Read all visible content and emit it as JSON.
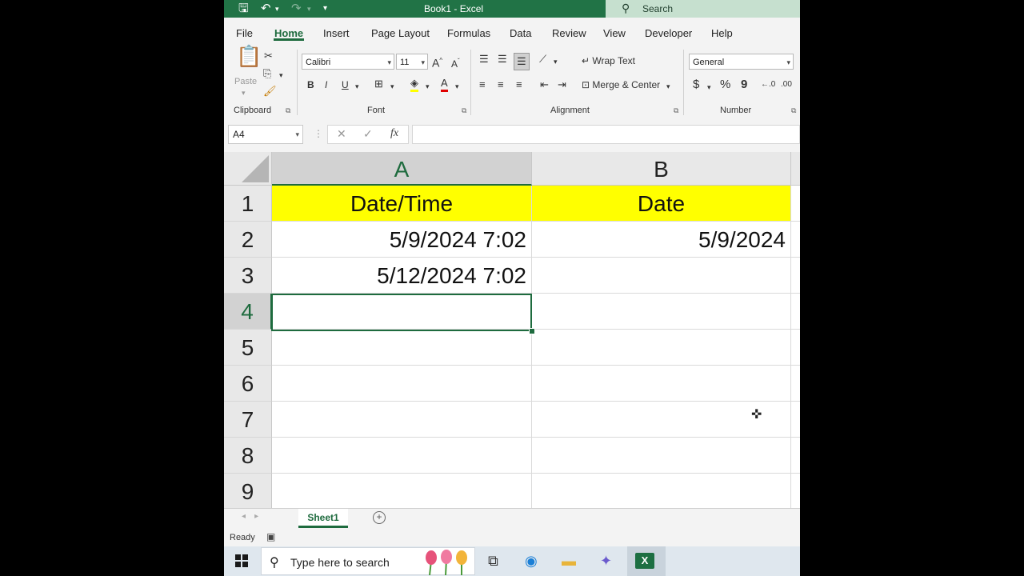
{
  "title_bar": {
    "title": "Book1  -  Excel",
    "search_placeholder": "Search"
  },
  "menu": {
    "tabs": [
      "File",
      "Home",
      "Insert",
      "Page Layout",
      "Formulas",
      "Data",
      "Review",
      "View",
      "Developer",
      "Help"
    ],
    "active": "Home"
  },
  "ribbon": {
    "clipboard": {
      "paste_label": "Paste",
      "group_label": "Clipboard"
    },
    "font": {
      "font_name": "Calibri",
      "font_size": "11",
      "bold": "B",
      "italic": "I",
      "underline": "U",
      "group_label": "Font"
    },
    "alignment": {
      "wrap_text": "Wrap Text",
      "merge_center": "Merge & Center",
      "group_label": "Alignment"
    },
    "number": {
      "format": "General",
      "currency": "$",
      "percent": "%",
      "comma": "9",
      "group_label": "Number"
    }
  },
  "formula_bar": {
    "name_box": "A4",
    "fx_label": "fx",
    "cancel_label": "✕",
    "enter_label": "✓",
    "content": ""
  },
  "sheet": {
    "columns": [
      "A",
      "B"
    ],
    "rows": [
      "1",
      "2",
      "3",
      "4",
      "5",
      "6",
      "7",
      "8",
      "9"
    ],
    "cells": {
      "A1": "Date/Time",
      "B1": "Date",
      "A2": "5/9/2024 7:02",
      "B2": "5/9/2024",
      "A3": "5/12/2024 7:02"
    },
    "header_fill": "#ffff00",
    "active_cell": "A4",
    "accent": "#1e6b3e"
  },
  "sheet_tabs": {
    "tabs": [
      "Sheet1"
    ],
    "active": "Sheet1"
  },
  "status": {
    "text": "Ready"
  },
  "taskbar": {
    "search_placeholder": "Type here to search",
    "excel_letter": "X"
  }
}
